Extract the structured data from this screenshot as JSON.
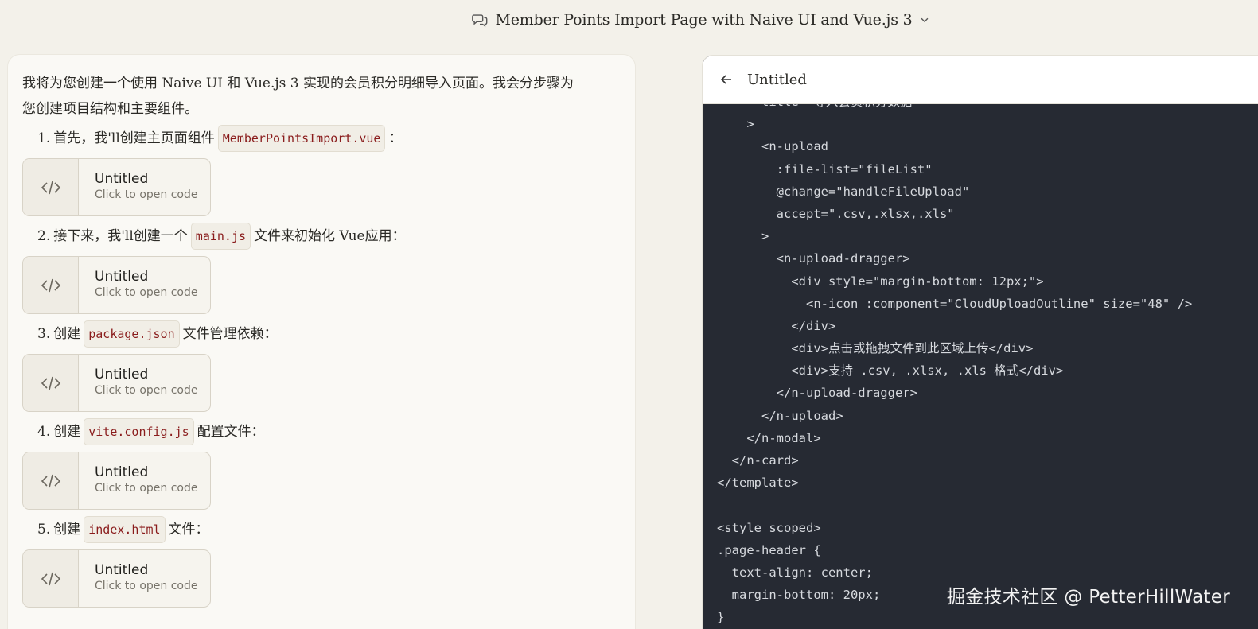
{
  "header": {
    "title": "Member Points Import Page with Naive UI and Vue.js 3",
    "chat_icon": "chat-bubbles-icon",
    "dropdown_icon": "chevron-down-icon"
  },
  "chat": {
    "intro": "我将为您创建一个使用 Naive UI 和 Vue.js 3 实现的会员积分明细导入页面。我会分步骤为您创建项目结构和主要组件。",
    "steps": [
      {
        "num": "1.",
        "before": "首先，我'll创建主页面组件",
        "code": "MemberPointsImport.vue",
        "after": "："
      },
      {
        "num": "2.",
        "before": "接下来，我'll创建一个",
        "code": "main.js",
        "after": "文件来初始化 Vue应用："
      },
      {
        "num": "3.",
        "before": "创建",
        "code": "package.json",
        "after": "文件管理依赖："
      },
      {
        "num": "4.",
        "before": "创建",
        "code": "vite.config.js",
        "after": "配置文件："
      },
      {
        "num": "5.",
        "before": "创建",
        "code": "index.html",
        "after": "文件："
      }
    ],
    "artifact": {
      "name": "Untitled",
      "sub": "Click to open code",
      "icon": "code-brackets-icon"
    }
  },
  "code_panel": {
    "title": "Untitled",
    "back_icon": "arrow-left-icon",
    "lines": [
      "      title=\"导入会员积分数据\"",
      "    >",
      "      <n-upload",
      "        :file-list=\"fileList\"",
      "        @change=\"handleFileUpload\"",
      "        accept=\".csv,.xlsx,.xls\"",
      "      >",
      "        <n-upload-dragger>",
      "          <div style=\"margin-bottom: 12px;\">",
      "            <n-icon :component=\"CloudUploadOutline\" size=\"48\" />",
      "          </div>",
      "          <div>点击或拖拽文件到此区域上传</div>",
      "          <div>支持 .csv, .xlsx, .xls 格式</div>",
      "        </n-upload-dragger>",
      "      </n-upload>",
      "    </n-modal>",
      "  </n-card>",
      "</template>",
      "",
      "<style scoped>",
      ".page-header {",
      "  text-align: center;",
      "  margin-bottom: 20px;",
      "}"
    ]
  },
  "watermark": "掘金技术社区 @ PetterHillWater"
}
